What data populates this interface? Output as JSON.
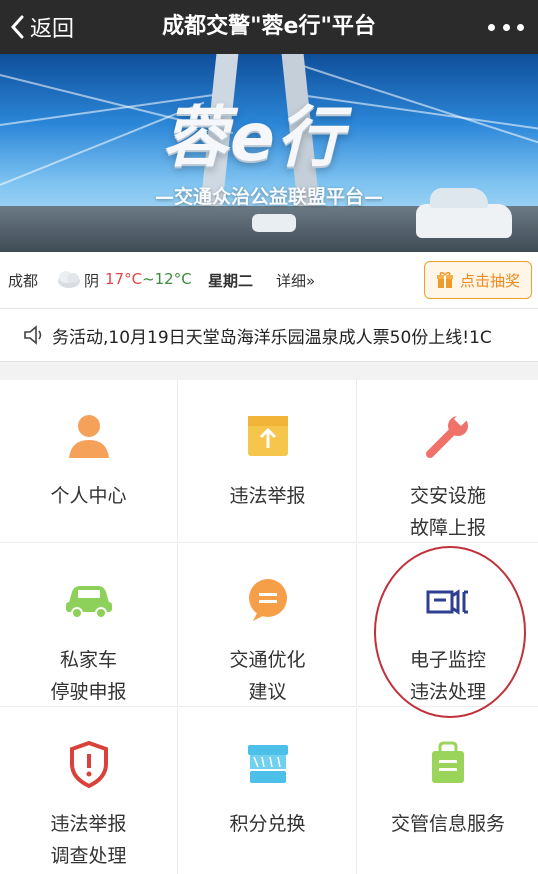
{
  "topbar": {
    "back_label": "返回",
    "title": "成都交警\"蓉e行\"平台"
  },
  "banner": {
    "brand": "蓉e行",
    "subtitle": "—交通众治公益联盟平台—"
  },
  "weather": {
    "city": "成都",
    "icon": "cloudy-icon",
    "condition": "阴",
    "temp_high": "17°C",
    "temp_sep": "~",
    "temp_low": "12°C",
    "weekday": "星期二",
    "detail": "详细»"
  },
  "lottery": {
    "label": "点击抽奖",
    "icon": "gift-icon"
  },
  "notice": {
    "icon": "speaker-icon",
    "text": "务活动,10月19日天堂岛海洋乐园温泉成人票50份上线!1C"
  },
  "menu": [
    {
      "line1": "个人中心",
      "line2": "",
      "icon": "person-icon",
      "color": "#f5a15a"
    },
    {
      "line1": "违法举报",
      "line2": "",
      "icon": "upload-box-icon",
      "color": "#f6c54b"
    },
    {
      "line1": "交安设施",
      "line2": "故障上报",
      "icon": "wrench-icon",
      "color": "#f0706a"
    },
    {
      "line1": "私家车",
      "line2": "停驶申报",
      "icon": "car-icon",
      "color": "#8dd05a"
    },
    {
      "line1": "交通优化",
      "line2": "建议",
      "icon": "chat-bubble-icon",
      "color": "#f5a049"
    },
    {
      "line1": "电子监控",
      "line2": "违法处理",
      "icon": "camera-icon",
      "color": "#2f3f8f"
    },
    {
      "line1": "违法举报",
      "line2": "调查处理",
      "icon": "alert-shield-icon",
      "color": "#d8423a"
    },
    {
      "line1": "积分兑换",
      "line2": "",
      "icon": "store-icon",
      "color": "#4cc0e8"
    },
    {
      "line1": "交管信息服务",
      "line2": "",
      "icon": "document-bag-icon",
      "color": "#9ad45a"
    }
  ]
}
